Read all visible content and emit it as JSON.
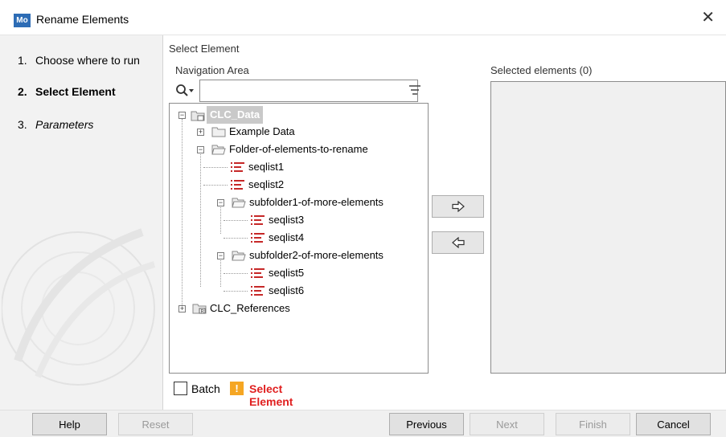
{
  "window": {
    "app_icon_text": "Mo",
    "title": "Rename Elements",
    "close_symbol": "✕"
  },
  "steps": [
    {
      "num": "1.",
      "label": "Choose where to run"
    },
    {
      "num": "2.",
      "label": "Select Element"
    },
    {
      "num": "3.",
      "label": "Parameters"
    }
  ],
  "panel": {
    "title": "Select Element",
    "navigation_label": "Navigation Area",
    "selected_label": "Selected elements (0)",
    "search_value": ""
  },
  "tree": {
    "root": "CLC_Data",
    "example_data": "Example Data",
    "folder": "Folder-of-elements-to-rename",
    "seqlist1": "seqlist1",
    "seqlist2": "seqlist2",
    "subfolder1": "subfolder1-of-more-elements",
    "seqlist3": "seqlist3",
    "seqlist4": "seqlist4",
    "subfolder2": "subfolder2-of-more-elements",
    "seqlist5": "seqlist5",
    "seqlist6": "seqlist6",
    "references": "CLC_References"
  },
  "batch": {
    "label": "Batch",
    "checked": false,
    "warning_icon": "!",
    "warning": "Select Element"
  },
  "footer": {
    "help": "Help",
    "reset": "Reset",
    "previous": "Previous",
    "next": "Next",
    "finish": "Finish",
    "cancel": "Cancel"
  },
  "colors": {
    "accent": "#2d6cb5",
    "warning": "#e02020",
    "seqlist_icon": "#c62828",
    "warning_icon_bg": "#f5a623"
  }
}
